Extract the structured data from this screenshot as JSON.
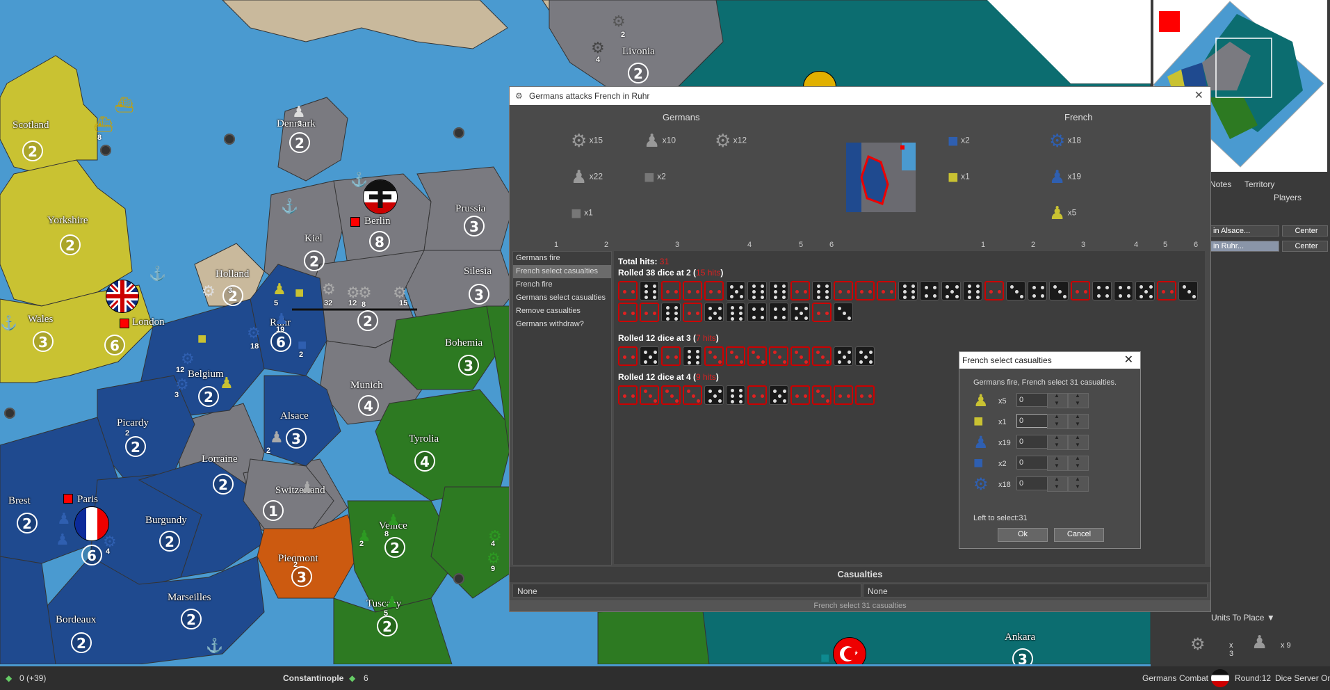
{
  "map": {
    "territories": [
      {
        "name": "Scotland",
        "pu": "2"
      },
      {
        "name": "Yorkshire",
        "pu": "2"
      },
      {
        "name": "Wales",
        "pu": "3"
      },
      {
        "name": "London",
        "pu": "6"
      },
      {
        "name": "Holland",
        "pu": "2"
      },
      {
        "name": "Denmark",
        "pu": "2"
      },
      {
        "name": "Kiel",
        "pu": "2"
      },
      {
        "name": "Berlin",
        "pu": "8"
      },
      {
        "name": "Prussia",
        "pu": "3"
      },
      {
        "name": "Silesia",
        "pu": "3"
      },
      {
        "name": "Ruhr",
        "pu": "6"
      },
      {
        "name": "Belgium",
        "pu": "2"
      },
      {
        "name": "Picardy",
        "pu": "2"
      },
      {
        "name": "Alsace",
        "pu": "3"
      },
      {
        "name": "Munich",
        "pu": "4"
      },
      {
        "name": "Bohemia",
        "pu": "3"
      },
      {
        "name": "Tyrolia",
        "pu": "4"
      },
      {
        "name": "Lorraine",
        "pu": "2"
      },
      {
        "name": "Switzerland",
        "pu": "1"
      },
      {
        "name": "Brest",
        "pu": "2"
      },
      {
        "name": "Paris",
        "pu": "6"
      },
      {
        "name": "Burgundy",
        "pu": "2"
      },
      {
        "name": "Piedmont",
        "pu": "3"
      },
      {
        "name": "Venice",
        "pu": "2"
      },
      {
        "name": "Marseilles",
        "pu": "2"
      },
      {
        "name": "Bordeaux",
        "pu": "2"
      },
      {
        "name": "Tuscany",
        "pu": "2"
      },
      {
        "name": "Livonia",
        "pu": "2"
      },
      {
        "name": "Ankara",
        "pu": "3"
      }
    ],
    "saxony_pu": "2",
    "unit_counts": {
      "livonia_a": "2",
      "livonia_b": "4",
      "denmark": "3",
      "scotland_sea": "8",
      "ruhr_inf": "5",
      "ruhr_a": "32",
      "ruhr_b": "12",
      "ruhr_c": "8",
      "ruhr_d": "15",
      "ruhr_e": "19",
      "ruhr_f": "18",
      "ruhr_g": "2",
      "belgium_a": "12",
      "belgium_b": "3",
      "picardy": "2",
      "alsace": "2",
      "paris": "4",
      "venice_a": "8",
      "venice_b": "2",
      "piedmont": "2",
      "tuscany": "5",
      "adriatic_a": "4",
      "adriatic_b": "9",
      "holland": "3"
    }
  },
  "side_panel": {
    "tabs": [
      "Notes",
      "Territory",
      "Players"
    ],
    "rows": [
      {
        "label": "in Alsace...",
        "button": "Center"
      },
      {
        "label": "in Ruhr...",
        "button": "Center"
      }
    ],
    "units_to_place": "Units To Place ▼",
    "place_units": [
      {
        "icon": "artillery-icon",
        "count": "x 3"
      },
      {
        "icon": "infantry-icon",
        "count": "x 9"
      }
    ]
  },
  "battle": {
    "title": "Germans attacks French in Ruhr",
    "attacker": "Germans",
    "defender": "French",
    "attacker_units": [
      {
        "icon": "artillery-icon",
        "count": "x15"
      },
      {
        "icon": "infantry-icon",
        "count": "x10"
      },
      {
        "icon": "heavy-artillery-icon",
        "count": "x12"
      },
      {
        "icon": "infantry-icon",
        "count": "x22"
      },
      {
        "icon": "tank-icon",
        "count": "x2"
      },
      {
        "icon": "armored-car-icon",
        "count": "x1"
      }
    ],
    "defender_units": [
      {
        "icon": "tank-icon",
        "count": "x2"
      },
      {
        "icon": "artillery-icon",
        "count": "x18"
      },
      {
        "icon": "tank-icon",
        "count": "x1"
      },
      {
        "icon": "infantry-icon",
        "count": "x19"
      },
      {
        "icon": "infantry-icon",
        "count": "x5"
      }
    ],
    "axis_ticks": [
      "1",
      "2",
      "3",
      "4",
      "5",
      "6"
    ],
    "steps": [
      "Germans fire",
      "French select casualties",
      "French fire",
      "Germans select casualties",
      "Remove casualties",
      "Germans withdraw?"
    ],
    "selected_step": 1,
    "total_hits_label": "Total hits:",
    "total_hits": "31",
    "rolls": [
      {
        "label": "Rolled 38 dice at 2 (",
        "hits": "15 hits",
        "suffix": ")",
        "dice": [
          2,
          6,
          2,
          2,
          2,
          5,
          6,
          6,
          2,
          6,
          2,
          2,
          2,
          6,
          4,
          5,
          6,
          2,
          3,
          4,
          3,
          2,
          4,
          4,
          5,
          2,
          3,
          2,
          2,
          6,
          2,
          5,
          6,
          4,
          4,
          5,
          2,
          3
        ]
      },
      {
        "label": "Rolled 12 dice at 3 (",
        "hits": "7 hits",
        "suffix": ")",
        "dice": [
          2,
          5,
          2,
          6,
          3,
          3,
          3,
          3,
          3,
          3,
          5,
          5
        ]
      },
      {
        "label": "Rolled 12 dice at 4 (",
        "hits": "9 hits",
        "suffix": ")",
        "dice": [
          2,
          3,
          3,
          3,
          5,
          6,
          2,
          5,
          2,
          3,
          2,
          2
        ]
      }
    ],
    "casualties_header": "Casualties",
    "casualties_left": "None",
    "casualties_right": "None",
    "status": "French select 31 casualties"
  },
  "dialog": {
    "title": "French select casualties",
    "message": "Germans fire,  French select 31 casualties.",
    "rows": [
      {
        "icon": "infantry-icon",
        "count": "x5",
        "value": "0",
        "color": "#c9c232"
      },
      {
        "icon": "tank-icon",
        "count": "x1",
        "value": "0",
        "color": "#c9c232"
      },
      {
        "icon": "infantry-icon",
        "count": "x19",
        "value": "0",
        "color": "#2f5fb0"
      },
      {
        "icon": "tank-icon",
        "count": "x2",
        "value": "0",
        "color": "#2f5fb0"
      },
      {
        "icon": "artillery-icon",
        "count": "x18",
        "value": "0",
        "color": "#2f5fb0"
      }
    ],
    "left_to_select": "Left to select:31",
    "ok": "Ok",
    "cancel": "Cancel"
  },
  "status_bar": {
    "pus": "0 (+39)",
    "territory": "Constantinople",
    "territory_pus": "6",
    "player": "Germans",
    "phase": "Combat",
    "round": "Round:12",
    "dice_server": "Dice Server On"
  },
  "colors": {
    "sea": "#4a9ad0",
    "germany": "#7a7a80",
    "britain": "#c9c232",
    "france": "#1f4a8f",
    "italy": "#2d7a22",
    "russia": "#0c6d70",
    "neutral": "#c9b99c",
    "hit": "#e02020"
  }
}
